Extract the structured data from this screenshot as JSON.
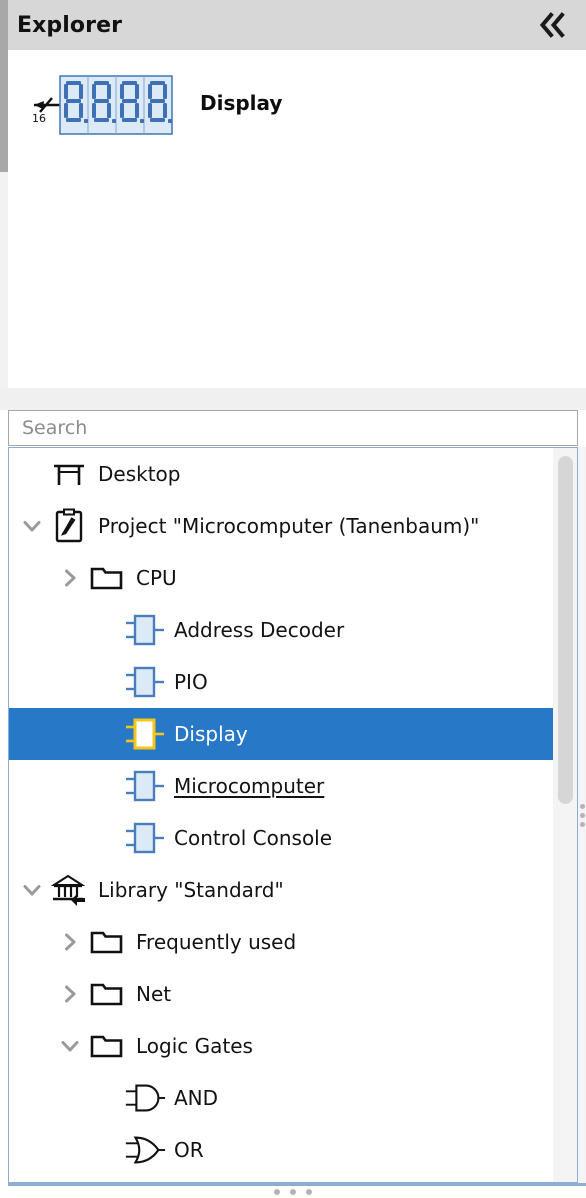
{
  "header": {
    "title": "Explorer",
    "collapse_icon": "chevron-double-left-icon"
  },
  "preview": {
    "label": "Display",
    "symbol": {
      "icon": "seven-segment-display-icon",
      "digits": 4,
      "digit_glyph": "8",
      "decimal_points": true,
      "bus_label": "16",
      "fill_color": "#dce9f6",
      "border_color": "#4a7ebb",
      "segment_color": "#3f6fb5"
    }
  },
  "search": {
    "placeholder": "Search",
    "value": ""
  },
  "tree": {
    "items": [
      {
        "label": "Desktop",
        "depth": 0,
        "icon": "desk-icon",
        "twisty": "none",
        "selected": false,
        "underlined": false
      },
      {
        "label": "Project \"Microcomputer (Tanenbaum)\"",
        "depth": 1,
        "icon": "clipboard-pencil-icon",
        "twisty": "expanded",
        "selected": false,
        "underlined": false
      },
      {
        "label": "CPU",
        "depth": 2,
        "icon": "folder-icon",
        "twisty": "collapsed",
        "selected": false,
        "underlined": false
      },
      {
        "label": "Address Decoder",
        "depth": 3,
        "icon": "circuit-icon",
        "twisty": "none",
        "selected": false,
        "underlined": false
      },
      {
        "label": "PIO",
        "depth": 3,
        "icon": "circuit-icon",
        "twisty": "none",
        "selected": false,
        "underlined": false
      },
      {
        "label": "Display",
        "depth": 3,
        "icon": "circuit-icon-selected",
        "twisty": "none",
        "selected": true,
        "underlined": false
      },
      {
        "label": "Microcomputer",
        "depth": 3,
        "icon": "circuit-icon",
        "twisty": "none",
        "selected": false,
        "underlined": true
      },
      {
        "label": "Control Console",
        "depth": 3,
        "icon": "circuit-icon",
        "twisty": "none",
        "selected": false,
        "underlined": false
      },
      {
        "label": "Library \"Standard\"",
        "depth": 1,
        "icon": "library-building-icon",
        "twisty": "expanded",
        "selected": false,
        "underlined": false
      },
      {
        "label": "Frequently used",
        "depth": 2,
        "icon": "folder-icon",
        "twisty": "collapsed",
        "selected": false,
        "underlined": false
      },
      {
        "label": "Net",
        "depth": 2,
        "icon": "folder-icon",
        "twisty": "collapsed",
        "selected": false,
        "underlined": false
      },
      {
        "label": "Logic Gates",
        "depth": 2,
        "icon": "folder-icon",
        "twisty": "expanded",
        "selected": false,
        "underlined": false
      },
      {
        "label": "AND",
        "depth": 3,
        "icon": "and-gate-icon",
        "twisty": "none",
        "selected": false,
        "underlined": false
      },
      {
        "label": "OR",
        "depth": 3,
        "icon": "or-gate-icon",
        "twisty": "none",
        "selected": false,
        "underlined": false
      }
    ]
  },
  "colors": {
    "header_bg": "#d7d7d7",
    "selection_blue": "#2878c8",
    "circuit_fill": "#dce9f6",
    "circuit_border": "#4a7ebb",
    "selected_icon_border": "#f5c518",
    "panel_border": "#8aaed6"
  }
}
